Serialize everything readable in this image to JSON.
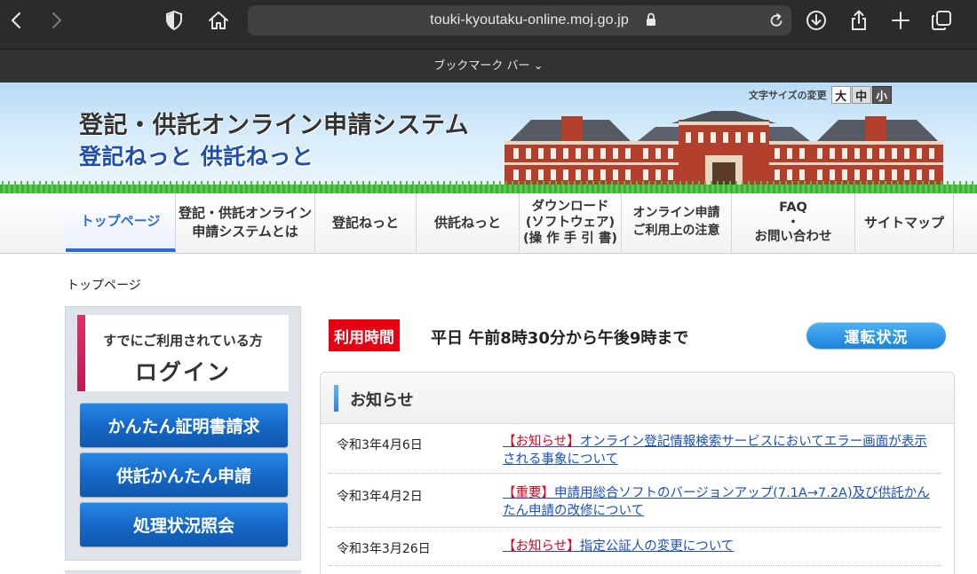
{
  "browser": {
    "url": "touki-kyoutaku-online.moj.go.jp",
    "bookmarks_label": "ブックマーク バー ⌄"
  },
  "header": {
    "title": "登記・供託オンライン申請システム",
    "subtitle": "登記ねっと 供託ねっと",
    "fontsize_label": "文字サイズの変更",
    "fontsize_large": "大",
    "fontsize_mid": "中",
    "fontsize_small": "小"
  },
  "nav": {
    "items": [
      {
        "line1": "トップページ",
        "line2": ""
      },
      {
        "line1": "登記・供託オンライン",
        "line2": "申請システムとは"
      },
      {
        "line1": "登記ねっと",
        "line2": ""
      },
      {
        "line1": "供託ねっと",
        "line2": ""
      },
      {
        "line1": "ダウンロード",
        "line2": "(ソフトウェア)",
        "line3": "(操 作 手 引 書)"
      },
      {
        "line1": "オンライン申請",
        "line2": "ご利用上の注意"
      },
      {
        "line1": "FAQ",
        "line2": "・",
        "line3": "お問い合わせ"
      },
      {
        "line1": "サイトマップ",
        "line2": ""
      }
    ]
  },
  "breadcrumb": "トップページ",
  "sidebar": {
    "login_sub": "すでにご利用されている方",
    "login_main": "ログイン",
    "btn1": "かんたん証明書請求",
    "btn2": "供託かんたん申請",
    "btn3": "処理状況照会"
  },
  "hours": {
    "badge": "利用時間",
    "text": "平日 午前8時30分から午後9時まで",
    "status_button": "運転状況"
  },
  "news": {
    "title": "お知らせ",
    "items": [
      {
        "date": "令和3年4月6日",
        "tag": "【お知らせ】",
        "text": "オンライン登記情報検索サービスにおいてエラー画面が表示される事象について"
      },
      {
        "date": "令和3年4月2日",
        "tag": "【重要】",
        "text": "申請用総合ソフトのバージョンアップ(7.1A→7.2A)及び供託かんたん申請の改修について"
      },
      {
        "date": "令和3年3月26日",
        "tag": "【お知らせ】",
        "text": "指定公証人の変更について"
      }
    ]
  }
}
